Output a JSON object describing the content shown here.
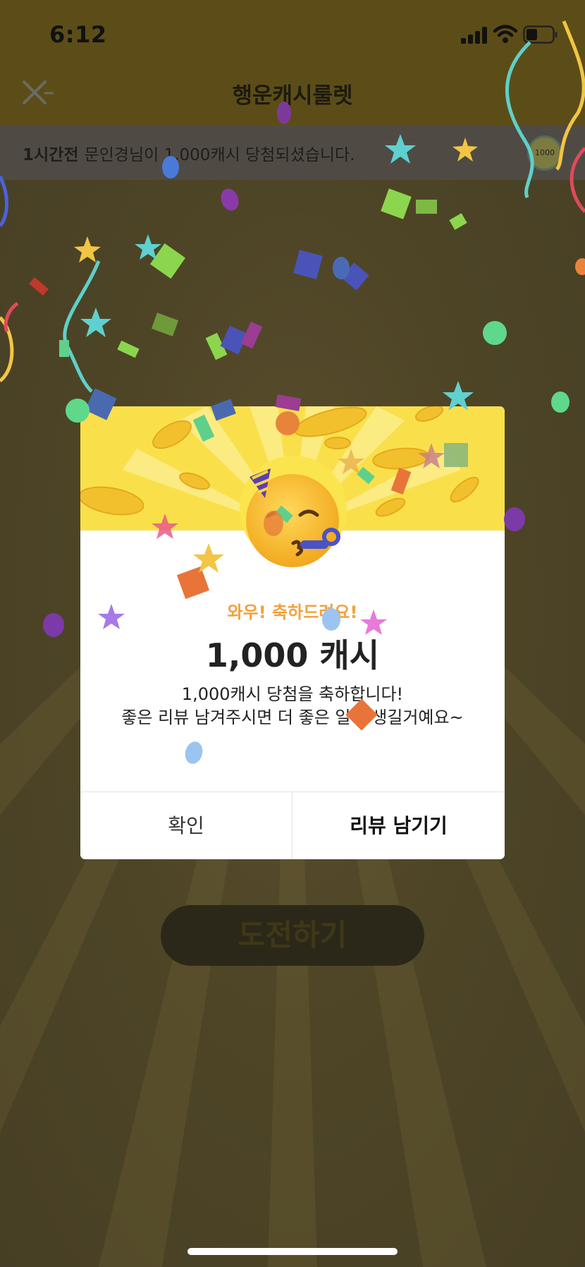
{
  "status_bar": {
    "time": "6:12",
    "icons": [
      "signal-icon",
      "wifi-icon",
      "battery-icon"
    ]
  },
  "nav": {
    "title": "행운캐시룰렛",
    "close_icon": "close-icon"
  },
  "ticker": {
    "time_ago": "1시간전",
    "message": "문인경님이 1,000캐시 당첨되셨습니다.",
    "coin_label": "1000"
  },
  "main": {
    "challenge_button": "도전하기"
  },
  "dialog": {
    "emoji": "party-face-emoji",
    "headline": "와우! 축하드려요!",
    "amount": "1,000 캐시",
    "message_line1": "1,000캐시 당첨을 축하합니다!",
    "message_line2": "좋은 리뷰 남겨주시면 더 좋은 일이 생길거예요~",
    "confirm_label": "확인",
    "review_label": "리뷰 남기기"
  },
  "colors": {
    "dim_background": "#4b4224",
    "banner_yellow": "#f9e04b",
    "headline_orange": "#f2a13c",
    "text_dark": "#222222"
  }
}
